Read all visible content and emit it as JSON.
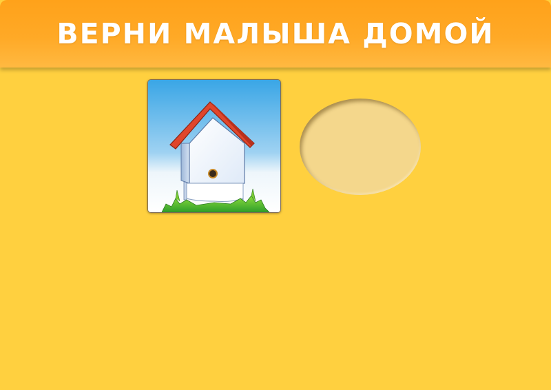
{
  "header": {
    "title": "ВЕРНИ МАЛЫША ДОМОЙ"
  },
  "colors": {
    "background": "#ffd03f",
    "header": "#ffa926",
    "hole": "#f4d78c",
    "roof": "#e0462c"
  },
  "pieces": [
    {
      "kind": "house",
      "icon": "birdhouse-icon"
    }
  ],
  "targets": [
    {
      "kind": "oval-slot"
    }
  ]
}
